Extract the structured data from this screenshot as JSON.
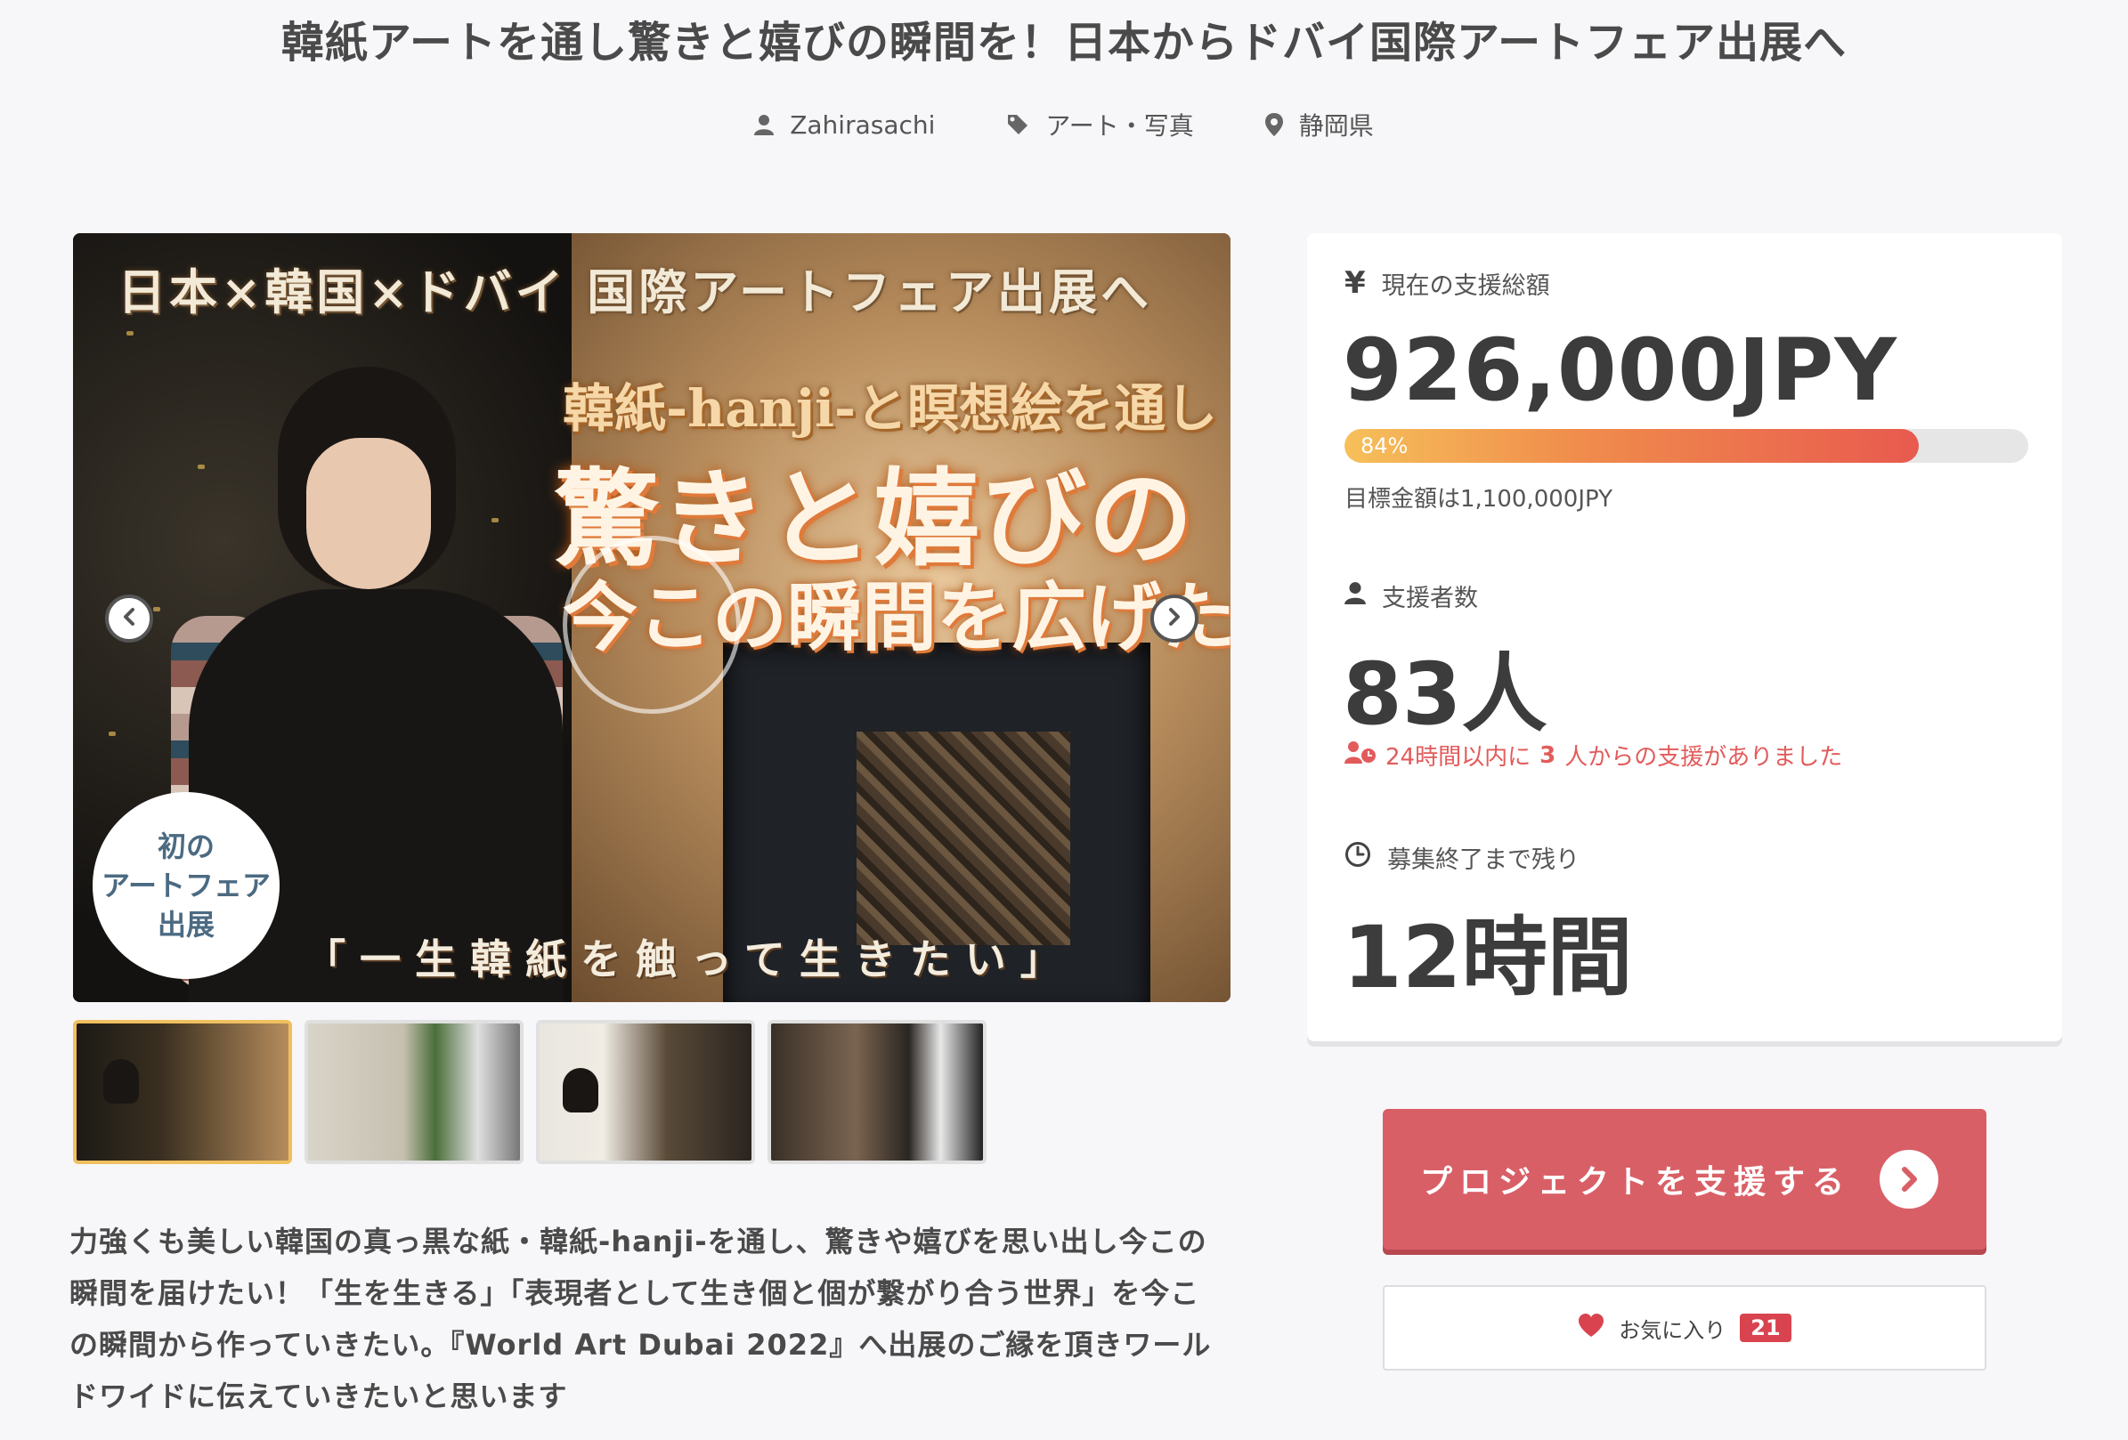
{
  "project": {
    "title": "韓紙アートを通し驚きと嬉びの瞬間を！日本からドバイ国際アートフェア出展へ",
    "author": "Zahirasachi",
    "category": "アート・写真",
    "location": "静岡県"
  },
  "hero": {
    "top_text": "日本×韓国×ドバイ 国際アートフェア出展へ",
    "line1": "韓紙-hanji-と瞑想絵を通し",
    "line2": "驚きと嬉びの",
    "line3": "今この瞬間を広げたい",
    "bottom_text": "「一生韓紙を触って生きたい」",
    "badge_lines": [
      "初の",
      "アートフェア",
      "出展"
    ]
  },
  "description": "力強くも美しい韓国の真っ黒な紙・韓紙-hanji-を通し、驚きや嬉びを思い出し今この瞬間を届けたい！「生を生きる」「表現者として生き個と個が繋がり合う世界」を今この瞬間から作っていきたい。『World Art Dubai 2022』へ出展のご縁を頂きワールドワイドに伝えていきたいと思います",
  "stats": {
    "amount_label": "現在の支援総額",
    "amount": "926,000JPY",
    "progress_percent_label": "84%",
    "progress_fraction": 0.84,
    "goal": "目標金額は1,100,000JPY",
    "backers_label": "支援者数",
    "backers": "83人",
    "recent_prefix": "24時間以内に",
    "recent_count": "3",
    "recent_suffix": "人からの支援がありました",
    "remaining_label": "募集終了まで残り",
    "remaining": "12時間"
  },
  "actions": {
    "support_label": "プロジェクトを支援する",
    "favorite_label": "お気に入り",
    "favorite_count": "21"
  },
  "colors": {
    "accent": "#d95f67",
    "alert": "#e25b5b",
    "progress_start": "#f6c05a",
    "progress_end": "#e85a4f"
  }
}
